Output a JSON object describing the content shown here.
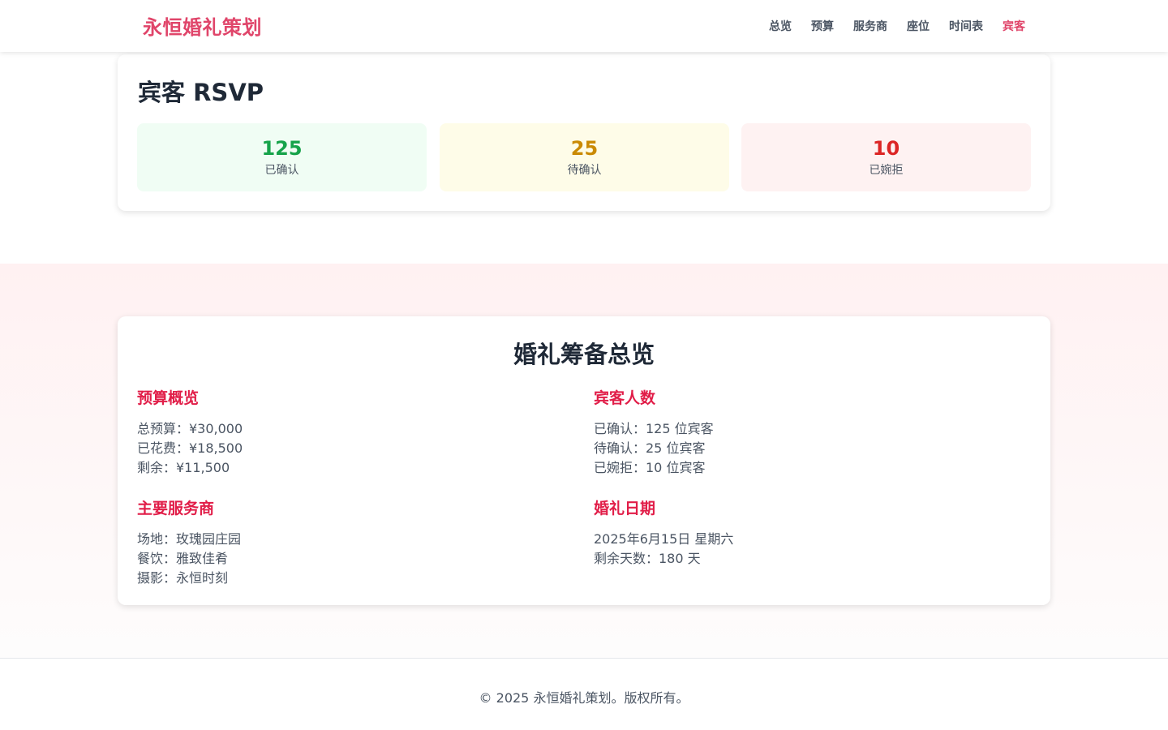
{
  "header": {
    "brand": "永恒婚礼策划",
    "nav": [
      {
        "label": "总览"
      },
      {
        "label": "预算"
      },
      {
        "label": "服务商"
      },
      {
        "label": "座位"
      },
      {
        "label": "时间表"
      },
      {
        "label": "宾客"
      }
    ],
    "active_nav": "宾客",
    "accent_color": "#e0456a"
  },
  "rsvp": {
    "title": "宾客 RSVP",
    "stats": [
      {
        "value": "125",
        "label": "已确认",
        "color": "#16a34a"
      },
      {
        "value": "25",
        "label": "待确认",
        "color": "#ca8a04"
      },
      {
        "value": "10",
        "label": "已婉拒",
        "color": "#dc2626"
      }
    ]
  },
  "overview": {
    "title": "婚礼筹备总览",
    "budget": {
      "heading": "预算概览",
      "lines": [
        "总预算：¥30,000",
        "已花费：¥18,500",
        "剩余：¥11,500"
      ]
    },
    "guests": {
      "heading": "宾客人数",
      "lines": [
        "已确认：125 位宾客",
        "待确认：25 位宾客",
        "已婉拒：10 位宾客"
      ]
    },
    "vendors": {
      "heading": "主要服务商",
      "lines": [
        "场地：玫瑰园庄园",
        "餐饮：雅致佳肴",
        "摄影：永恒时刻"
      ]
    },
    "date": {
      "heading": "婚礼日期",
      "lines": [
        "2025年6月15日 星期六",
        "剩余天数：180 天"
      ]
    }
  },
  "footer": {
    "text": "© 2025 永恒婚礼策划。版权所有。"
  }
}
